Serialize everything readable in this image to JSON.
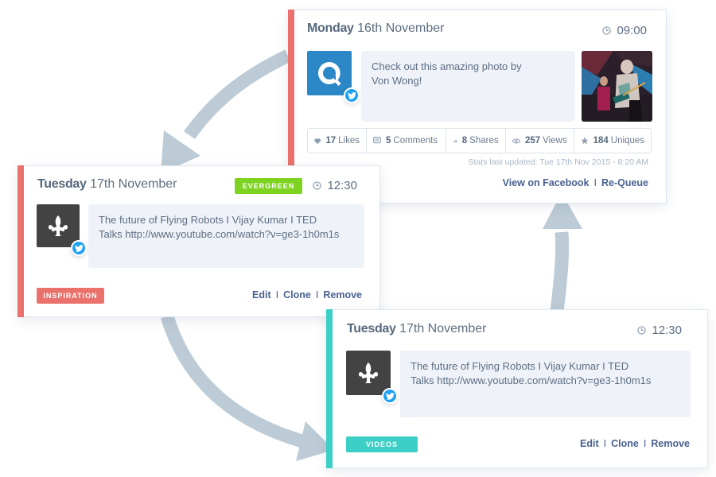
{
  "colors": {
    "accent_red": "#ea716c",
    "accent_teal": "#3ccfc6",
    "evergreen": "#7ed321",
    "twitter": "#1da1f2",
    "arrow": "#bccbd5",
    "link": "#4a6190",
    "avatar_blue": "#2b87c6",
    "avatar_dark": "#434343"
  },
  "card_top": {
    "day": "Monday",
    "date": "16th November",
    "time": "09:00",
    "avatar_icon": "q-logo-icon",
    "text_line1": "Check out this amazing photo by",
    "text_line2": "Von Wong!",
    "photo_alt": "concert photo",
    "stats": [
      {
        "icon": "heart-icon",
        "value": "17",
        "label": "Likes"
      },
      {
        "icon": "comment-icon",
        "value": "5",
        "label": "Comments"
      },
      {
        "icon": "share-icon",
        "value": "8",
        "label": "Shares"
      },
      {
        "icon": "eye-icon",
        "value": "257",
        "label": "Views"
      },
      {
        "icon": "star-icon",
        "value": "184",
        "label": "Uniques"
      }
    ],
    "stats_updated": "Stats last updated: Tue 17th Nov 2015 - 8:20 AM",
    "link_view": "View on Facebook",
    "link_requeue": "Re-Queue",
    "separator": "I"
  },
  "card_left": {
    "day": "Tuesday",
    "date": "17th November",
    "badge": "EVERGREEN",
    "time": "12:30",
    "avatar_icon": "fleur-de-lis-icon",
    "text_line1": "The future of Flying Robots I Vijay Kumar I TED",
    "text_line2": "Talks http://www.youtube.com/watch?v=ge3-1h0m1s",
    "tag": "INSPIRATION",
    "link_edit": "Edit",
    "link_clone": "Clone",
    "link_remove": "Remove",
    "separator": "I"
  },
  "card_bottom": {
    "day": "Tuesday",
    "date": "17th November",
    "time": "12:30",
    "avatar_icon": "fleur-de-lis-icon",
    "text_line1": "The future of Flying Robots I Vijay Kumar I TED",
    "text_line2": "Talks http://www.youtube.com/watch?v=ge3-1h0m1s",
    "tag": "VIDEOS",
    "link_edit": "Edit",
    "link_clone": "Clone",
    "link_remove": "Remove",
    "separator": "I"
  }
}
